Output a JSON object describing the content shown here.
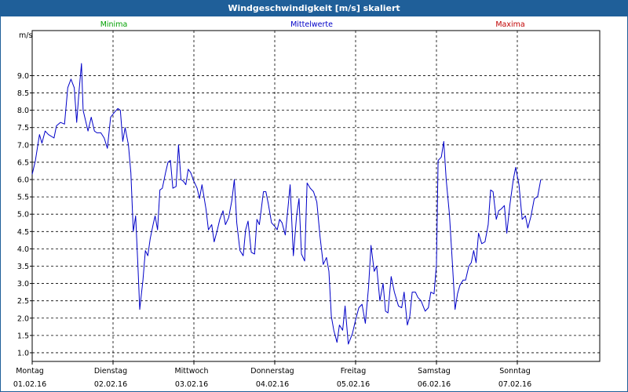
{
  "window": {
    "title": "Windgeschwindigkeit [m/s] skaliert"
  },
  "legend": {
    "min": "Minima",
    "mean": "Mittelwerte",
    "max": "Maxima"
  },
  "colors": {
    "titlebar": "#1f5f99",
    "min": "#00a000",
    "mean": "#0000c8",
    "max": "#c00000",
    "grid": "#000000",
    "axis_text": "#000000"
  },
  "chart_data": {
    "type": "line",
    "title": "Windgeschwindigkeit [m/s] skaliert",
    "ylabel": "m/s",
    "xlabel": "",
    "ylim": [
      0.75,
      10.3
    ],
    "yticks": [
      1.0,
      1.5,
      2.0,
      2.5,
      3.0,
      3.5,
      4.0,
      4.5,
      5.0,
      5.5,
      6.0,
      6.5,
      7.0,
      7.5,
      8.0,
      8.5,
      9.0
    ],
    "ytick_labels": [
      "1.0",
      "1.5",
      "2.0",
      "2.5",
      "3.0",
      "3.5",
      "4.0",
      "4.5",
      "5.0",
      "5.5",
      "6.0",
      "6.5",
      "7.0",
      "7.5",
      "8.0",
      "8.5",
      "9.0"
    ],
    "xlim": [
      0,
      7
    ],
    "x_unit": "days from 01.02.16 00:00",
    "x_ticks": [
      {
        "day": "Montag",
        "date": "01.02.16"
      },
      {
        "day": "Dienstag",
        "date": "02.02.16"
      },
      {
        "day": "Mittwoch",
        "date": "03.02.16"
      },
      {
        "day": "Donnerstag",
        "date": "04.02.16"
      },
      {
        "day": "Freitag",
        "date": "05.02.16"
      },
      {
        "day": "Samstag",
        "date": "06.02.16"
      },
      {
        "day": "Sonntag",
        "date": "07.02.16"
      }
    ],
    "grid": true,
    "legend_position": "top",
    "series": [
      {
        "name": "Mittelwerte",
        "color": "#0000c8",
        "points": [
          [
            0.0,
            6.15
          ],
          [
            0.04,
            6.55
          ],
          [
            0.09,
            7.3
          ],
          [
            0.12,
            7.05
          ],
          [
            0.16,
            7.4
          ],
          [
            0.2,
            7.3
          ],
          [
            0.27,
            7.2
          ],
          [
            0.3,
            7.55
          ],
          [
            0.35,
            7.65
          ],
          [
            0.4,
            7.6
          ],
          [
            0.44,
            8.65
          ],
          [
            0.48,
            8.9
          ],
          [
            0.52,
            8.65
          ],
          [
            0.55,
            7.65
          ],
          [
            0.58,
            8.55
          ],
          [
            0.61,
            9.35
          ],
          [
            0.63,
            8.0
          ],
          [
            0.66,
            7.7
          ],
          [
            0.69,
            7.4
          ],
          [
            0.73,
            7.8
          ],
          [
            0.77,
            7.4
          ],
          [
            0.8,
            7.35
          ],
          [
            0.85,
            7.35
          ],
          [
            0.89,
            7.2
          ],
          [
            0.93,
            6.9
          ],
          [
            0.97,
            7.8
          ],
          [
            1.02,
            7.95
          ],
          [
            1.06,
            8.05
          ],
          [
            1.09,
            8.0
          ],
          [
            1.12,
            7.1
          ],
          [
            1.15,
            7.5
          ],
          [
            1.19,
            7.0
          ],
          [
            1.22,
            6.2
          ],
          [
            1.25,
            4.5
          ],
          [
            1.28,
            4.95
          ],
          [
            1.31,
            3.4
          ],
          [
            1.33,
            2.25
          ],
          [
            1.37,
            3.1
          ],
          [
            1.4,
            3.95
          ],
          [
            1.43,
            3.8
          ],
          [
            1.46,
            4.3
          ],
          [
            1.5,
            4.75
          ],
          [
            1.52,
            4.95
          ],
          [
            1.55,
            4.55
          ],
          [
            1.58,
            5.7
          ],
          [
            1.61,
            5.75
          ],
          [
            1.65,
            6.2
          ],
          [
            1.68,
            6.5
          ],
          [
            1.71,
            6.55
          ],
          [
            1.74,
            5.75
          ],
          [
            1.78,
            5.8
          ],
          [
            1.81,
            7.0
          ],
          [
            1.84,
            6.0
          ],
          [
            1.87,
            5.95
          ],
          [
            1.9,
            5.85
          ],
          [
            1.93,
            6.3
          ],
          [
            1.96,
            6.2
          ],
          [
            2.0,
            5.95
          ],
          [
            2.04,
            5.75
          ],
          [
            2.07,
            5.45
          ],
          [
            2.1,
            5.85
          ],
          [
            2.15,
            5.15
          ],
          [
            2.18,
            4.55
          ],
          [
            2.22,
            4.7
          ],
          [
            2.25,
            4.2
          ],
          [
            2.29,
            4.55
          ],
          [
            2.32,
            4.85
          ],
          [
            2.36,
            5.1
          ],
          [
            2.39,
            4.7
          ],
          [
            2.43,
            4.9
          ],
          [
            2.47,
            5.4
          ],
          [
            2.5,
            6.0
          ],
          [
            2.53,
            4.75
          ],
          [
            2.57,
            3.95
          ],
          [
            2.61,
            3.8
          ],
          [
            2.64,
            4.55
          ],
          [
            2.67,
            4.8
          ],
          [
            2.71,
            3.9
          ],
          [
            2.75,
            3.85
          ],
          [
            2.78,
            4.85
          ],
          [
            2.81,
            4.7
          ],
          [
            2.86,
            5.65
          ],
          [
            2.89,
            5.65
          ],
          [
            2.92,
            5.3
          ],
          [
            2.96,
            4.75
          ],
          [
            3.0,
            4.65
          ],
          [
            3.03,
            4.55
          ],
          [
            3.06,
            4.85
          ],
          [
            3.09,
            4.75
          ],
          [
            3.13,
            4.4
          ],
          [
            3.16,
            5.1
          ],
          [
            3.19,
            5.85
          ],
          [
            3.23,
            3.8
          ],
          [
            3.27,
            4.95
          ],
          [
            3.3,
            5.45
          ],
          [
            3.33,
            3.85
          ],
          [
            3.37,
            3.65
          ],
          [
            3.4,
            5.9
          ],
          [
            3.44,
            5.75
          ],
          [
            3.48,
            5.65
          ],
          [
            3.52,
            5.35
          ],
          [
            3.56,
            4.35
          ],
          [
            3.6,
            3.55
          ],
          [
            3.64,
            3.75
          ],
          [
            3.67,
            3.35
          ],
          [
            3.7,
            2.05
          ],
          [
            3.73,
            1.65
          ],
          [
            3.77,
            1.3
          ],
          [
            3.8,
            1.8
          ],
          [
            3.84,
            1.65
          ],
          [
            3.87,
            2.35
          ],
          [
            3.91,
            1.25
          ],
          [
            3.96,
            1.55
          ],
          [
            4.0,
            1.95
          ],
          [
            4.04,
            2.3
          ],
          [
            4.08,
            2.4
          ],
          [
            4.12,
            1.85
          ],
          [
            4.16,
            2.9
          ],
          [
            4.19,
            4.1
          ],
          [
            4.23,
            3.35
          ],
          [
            4.26,
            3.5
          ],
          [
            4.3,
            2.5
          ],
          [
            4.34,
            3.0
          ],
          [
            4.37,
            2.2
          ],
          [
            4.4,
            2.15
          ],
          [
            4.44,
            3.2
          ],
          [
            4.48,
            2.75
          ],
          [
            4.53,
            2.35
          ],
          [
            4.57,
            2.3
          ],
          [
            4.6,
            2.75
          ],
          [
            4.64,
            1.8
          ],
          [
            4.67,
            2.05
          ],
          [
            4.7,
            2.75
          ],
          [
            4.74,
            2.75
          ],
          [
            4.77,
            2.6
          ],
          [
            4.81,
            2.5
          ],
          [
            4.86,
            2.2
          ],
          [
            4.9,
            2.3
          ],
          [
            4.93,
            2.75
          ],
          [
            4.97,
            2.7
          ],
          [
            5.0,
            3.55
          ],
          [
            5.02,
            6.55
          ],
          [
            5.06,
            6.65
          ],
          [
            5.09,
            7.1
          ],
          [
            5.12,
            6.0
          ],
          [
            5.16,
            5.0
          ],
          [
            5.19,
            3.85
          ],
          [
            5.23,
            2.25
          ],
          [
            5.26,
            2.7
          ],
          [
            5.29,
            2.95
          ],
          [
            5.33,
            3.1
          ],
          [
            5.36,
            3.1
          ],
          [
            5.4,
            3.5
          ],
          [
            5.43,
            3.6
          ],
          [
            5.46,
            3.95
          ],
          [
            5.49,
            3.6
          ],
          [
            5.52,
            4.45
          ],
          [
            5.56,
            4.15
          ],
          [
            5.6,
            4.2
          ],
          [
            5.64,
            4.7
          ],
          [
            5.67,
            5.7
          ],
          [
            5.7,
            5.65
          ],
          [
            5.74,
            4.85
          ],
          [
            5.77,
            5.1
          ],
          [
            5.8,
            5.15
          ],
          [
            5.84,
            5.25
          ],
          [
            5.87,
            4.45
          ],
          [
            5.91,
            5.3
          ],
          [
            5.95,
            6.0
          ],
          [
            5.98,
            6.35
          ],
          [
            6.02,
            5.85
          ],
          [
            6.06,
            4.85
          ],
          [
            6.1,
            4.95
          ],
          [
            6.13,
            4.6
          ],
          [
            6.17,
            4.95
          ],
          [
            6.21,
            5.45
          ],
          [
            6.25,
            5.5
          ],
          [
            6.29,
            6.0
          ]
        ]
      }
    ]
  }
}
